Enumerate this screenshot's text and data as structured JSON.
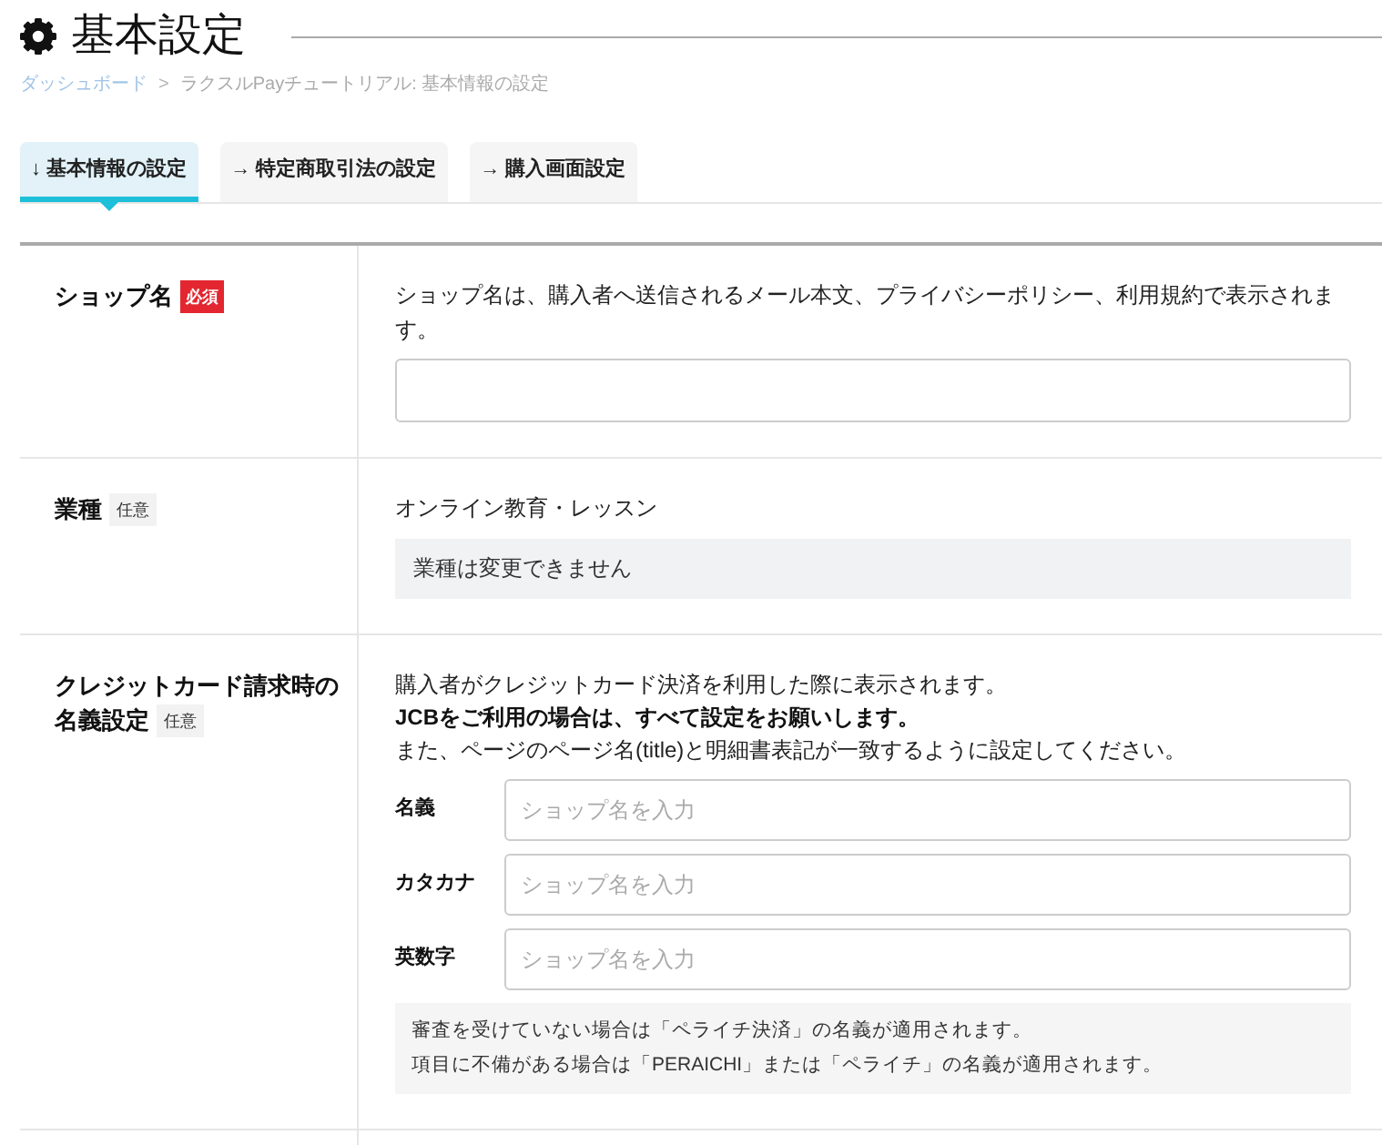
{
  "page": {
    "title": "基本設定"
  },
  "breadcrumb": [
    {
      "kind": "link",
      "text": "ダッシュボード"
    },
    {
      "kind": "separator",
      "text": ">"
    },
    {
      "kind": "current",
      "text": "ラクスルPayチュートリアル: 基本情報の設定"
    }
  ],
  "tabs": [
    {
      "label": "↓ 基本情報の設定",
      "selected": true
    },
    {
      "label": "→ 特定商取引法の設定",
      "selected": false
    },
    {
      "label": "→ 購入画面設定",
      "selected": false
    }
  ],
  "form_rows": [
    {
      "label_lines": [
        "ショップ名"
      ],
      "badge": {
        "kind": "required",
        "text": "必須"
      },
      "content": [
        {
          "kind": "text",
          "text": "ショップ名は、購入者へ送信されるメール本文、プライバシーポリシー、利用規約で表示されます。"
        },
        {
          "kind": "input"
        }
      ]
    },
    {
      "label_lines": [
        "業種"
      ],
      "badge": {
        "kind": "optional",
        "text": "任意"
      },
      "content": [
        {
          "kind": "text",
          "text": "オンライン教育・レッスン"
        },
        {
          "kind": "readonly",
          "text": "業種は変更できません"
        }
      ]
    },
    {
      "label_lines": [
        "クレジットカード請求時の",
        "名義設定"
      ],
      "badge": {
        "kind": "optional",
        "text": "任意"
      },
      "content": [
        {
          "kind": "text",
          "text": "購入者がクレジットカード決済を利用した際に表示されます。"
        },
        {
          "kind": "bold_text",
          "text": "JCBをご利用の場合は、すべて設定をお願いします。"
        },
        {
          "kind": "text",
          "text": "また、ページのページ名(title)と明細書表記が一致するように設定してください。"
        },
        {
          "kind": "labeled_input",
          "label": "名義",
          "placeholder": "ショップ名を入力"
        },
        {
          "kind": "labeled_input",
          "label": "カタカナ",
          "placeholder": "ショップ名を入力"
        },
        {
          "kind": "labeled_input",
          "label": "英数字",
          "placeholder": "ショップ名を入力"
        },
        {
          "kind": "note",
          "lines": [
            "審査を受けていない場合は「ペライチ決済」の名義が適用されます。",
            "項目に不備がある場合は「PERAICHI」または「ペライチ」の名義が適用されます。"
          ]
        }
      ]
    }
  ]
}
